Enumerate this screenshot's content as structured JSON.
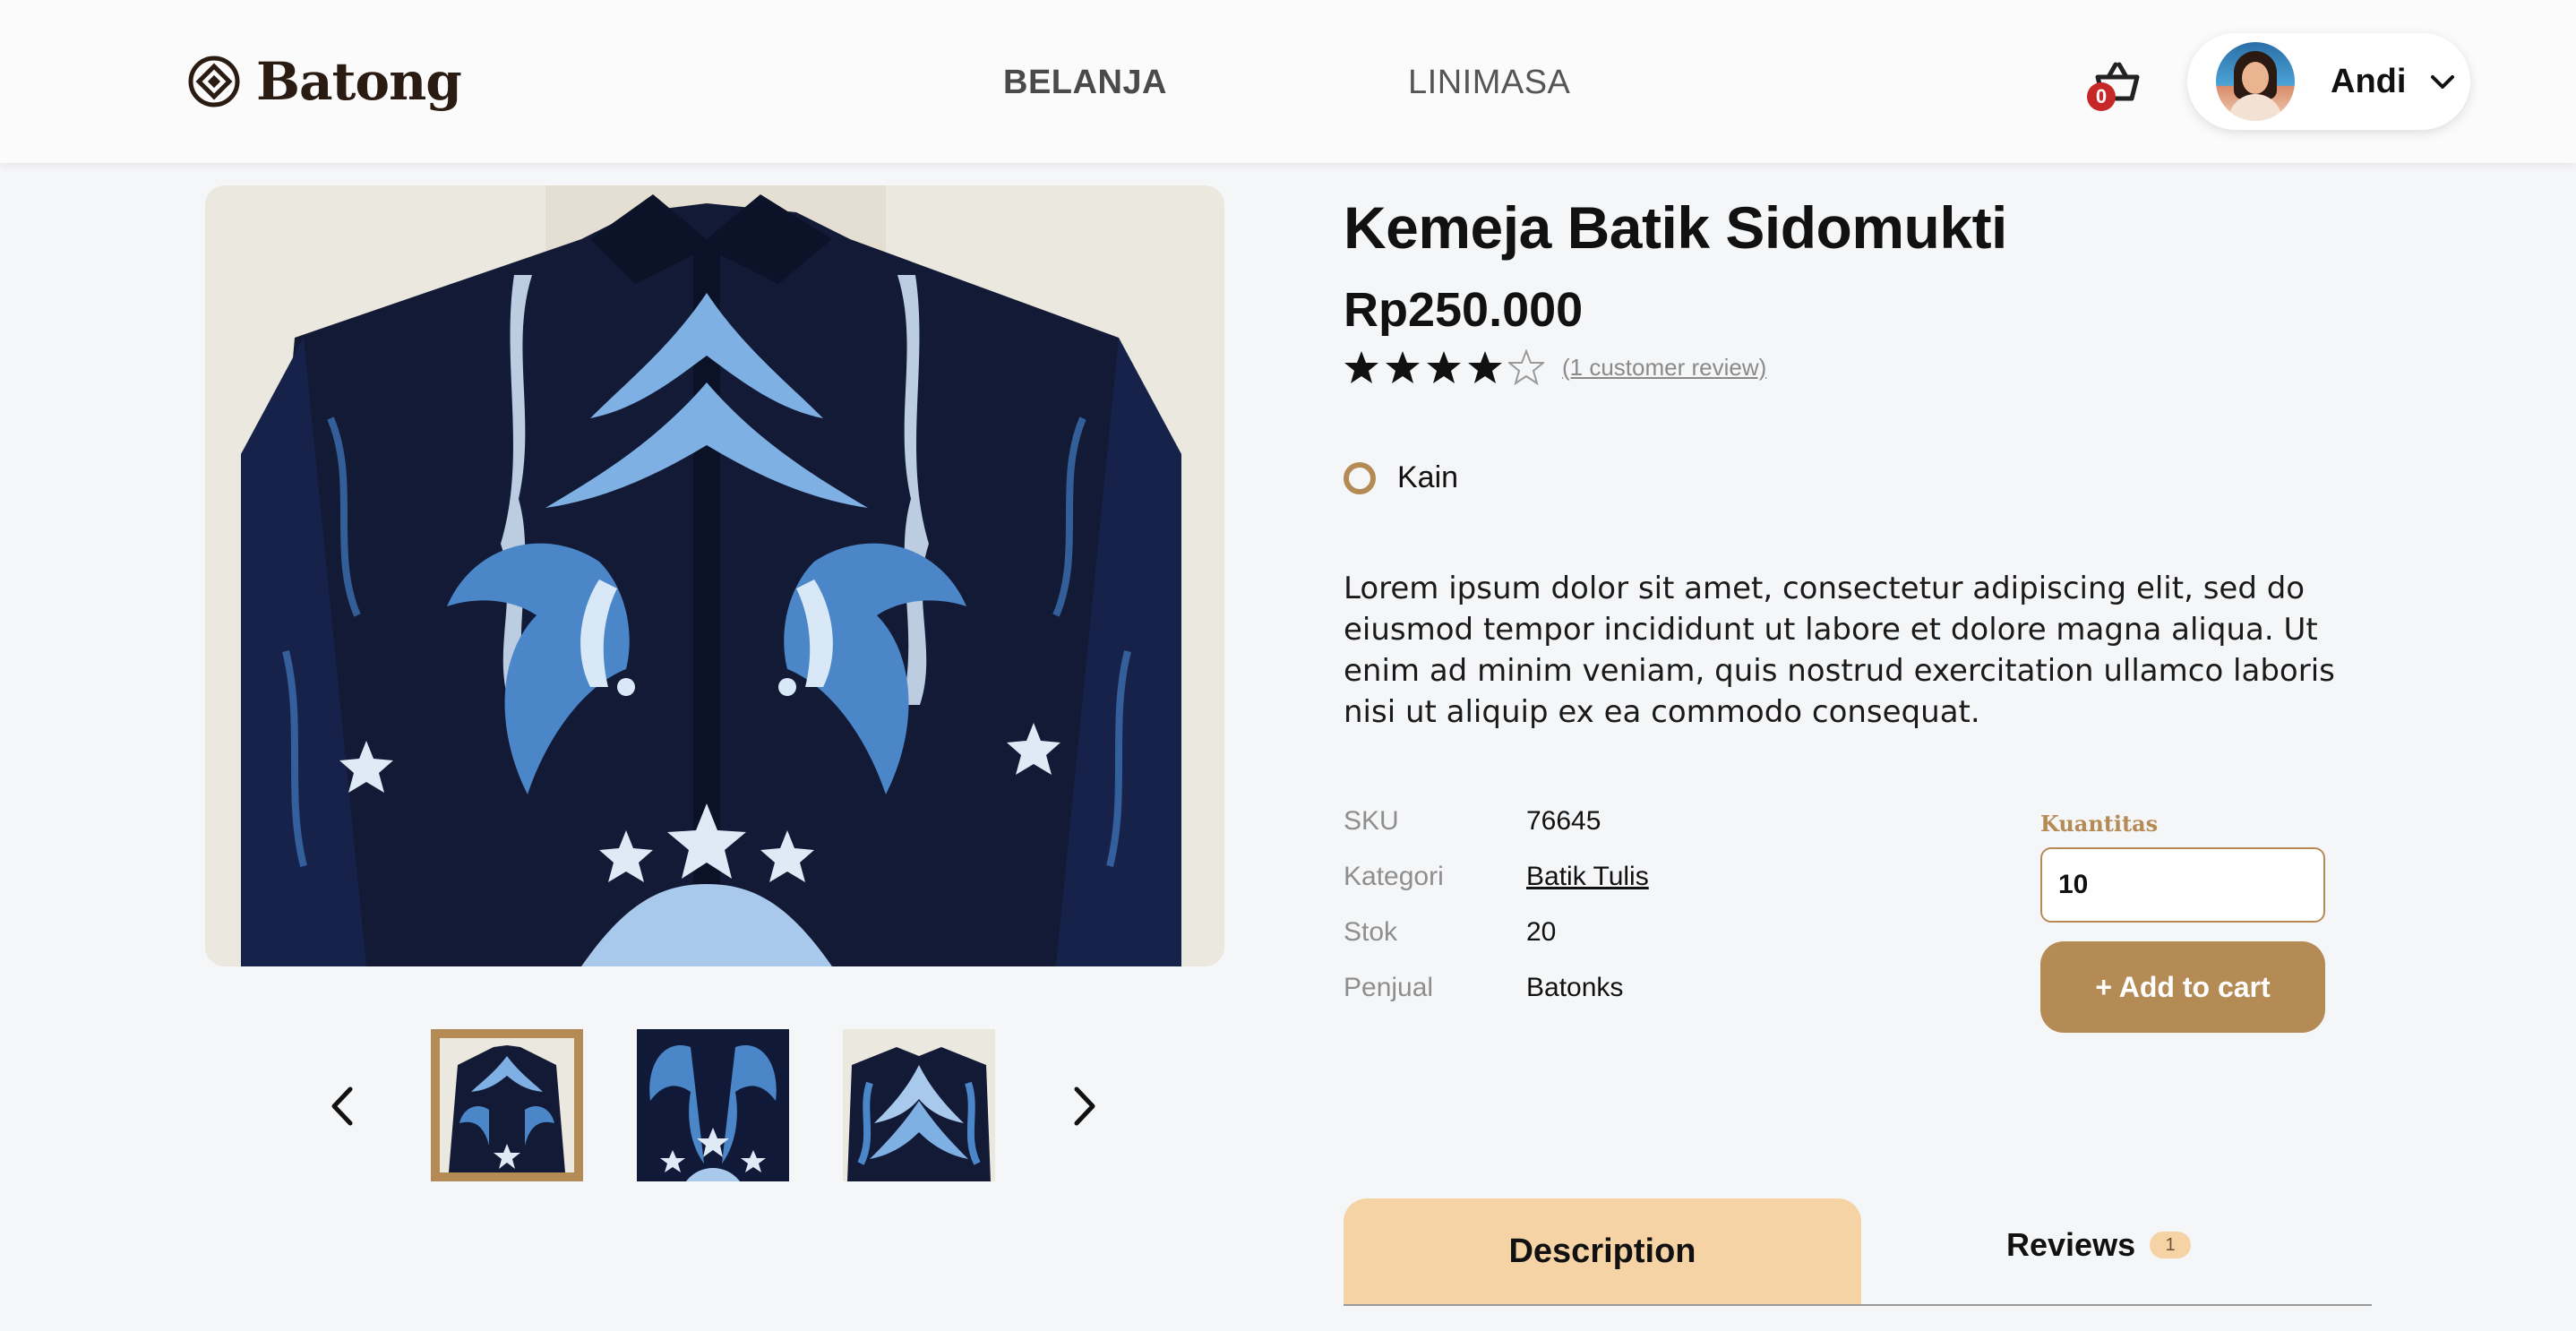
{
  "header": {
    "logo_text": "Batong",
    "nav": {
      "shop": "BELANJA",
      "timeline": "LINIMASA"
    },
    "cart_count": "0",
    "user_name": "Andi"
  },
  "product": {
    "title": "Kemeja Batik Sidomukti",
    "price": "Rp250.000",
    "rating": 4,
    "rating_max": 5,
    "review_link": "(1 customer review)",
    "option_label": "Kain",
    "description": "Lorem ipsum dolor sit amet, consectetur adipiscing elit, sed do eiusmod tempor incididunt ut labore et dolore magna aliqua. Ut enim ad minim veniam, quis nostrud exercitation ullamco laboris nisi ut aliquip ex ea commodo consequat.",
    "meta": {
      "sku_label": "SKU",
      "sku": "76645",
      "category_label": "Kategori",
      "category": "Batik Tulis",
      "stock_label": "Stok",
      "stock": "20",
      "seller_label": "Penjual",
      "seller": "Batonks"
    }
  },
  "purchase": {
    "qty_label": "Kuantitas",
    "qty_value": "10",
    "add_to_cart": "+ Add to cart"
  },
  "tabs": {
    "description": "Description",
    "reviews": "Reviews",
    "reviews_count": "1"
  },
  "colors": {
    "accent": "#b58b55",
    "tab_active": "#f5d3a5",
    "badge_red": "#c62828"
  }
}
